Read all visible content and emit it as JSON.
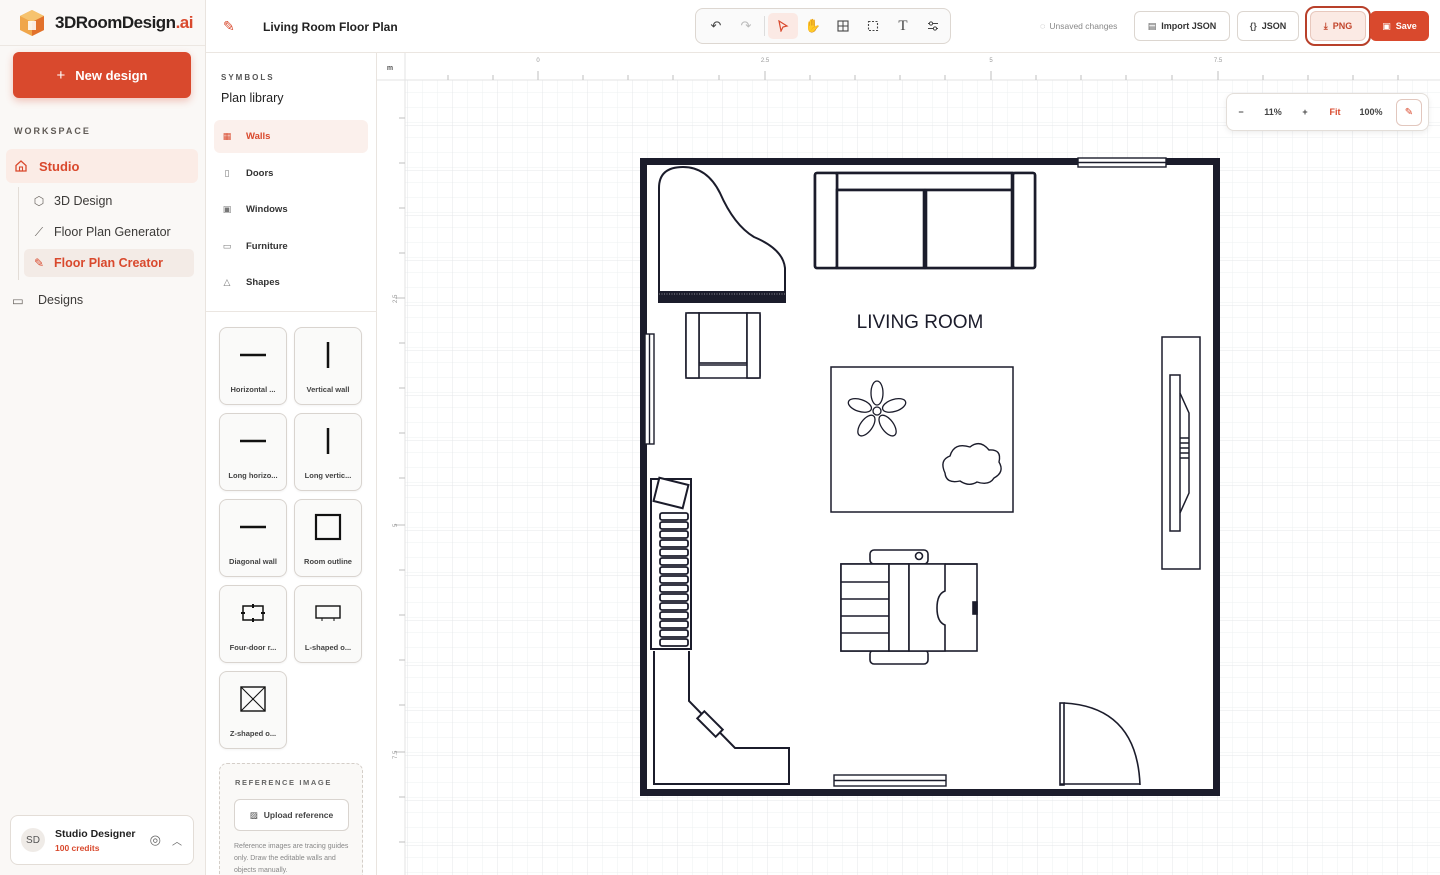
{
  "brand": {
    "name_main": "3DRoomDesign",
    "name_suffix": ".ai"
  },
  "sidebar": {
    "new_design": "New design",
    "workspace_label": "WORKSPACE",
    "studio": "Studio",
    "items": [
      {
        "label": "3D Design",
        "icon": "cube-icon"
      },
      {
        "label": "Floor Plan Generator",
        "icon": "magic-wand-icon"
      },
      {
        "label": "Floor Plan Creator",
        "icon": "ruler-icon",
        "active": true
      }
    ],
    "designs": "Designs",
    "user": {
      "initials": "SD",
      "name": "Studio Designer",
      "credits": "100 credits"
    }
  },
  "header": {
    "title": "Living Room Floor Plan",
    "unsaved": "Unsaved changes",
    "import_json": "Import JSON",
    "json": "JSON",
    "png": "PNG",
    "save": "Save",
    "tools": [
      "undo-icon",
      "redo-icon",
      "select-icon",
      "hand-icon",
      "grid-icon",
      "marquee-icon",
      "text-icon",
      "settings-icon"
    ]
  },
  "symbols": {
    "section_label": "SYMBOLS",
    "title": "Plan library",
    "categories": [
      "Walls",
      "Doors",
      "Windows",
      "Furniture",
      "Shapes"
    ],
    "tiles": [
      "Horizontal ...",
      "Vertical wall",
      "Long horizo...",
      "Long vertic...",
      "Diagonal wall",
      "Room outline",
      "Four-door r...",
      "L-shaped o...",
      "Z-shaped o..."
    ],
    "reference": {
      "label": "REFERENCE IMAGE",
      "upload": "Upload reference",
      "note": "Reference images are tracing guides only. Draw the editable walls and objects manually."
    }
  },
  "canvas": {
    "unit": "m",
    "ruler_x": [
      "0",
      "2.5",
      "5",
      "7.5"
    ],
    "ruler_y": [
      "2.5",
      "5",
      "7.5"
    ],
    "room_label": "LIVING ROOM",
    "zoom": {
      "minus": "−",
      "value": "11%",
      "plus": "+",
      "fit": "Fit",
      "full": "100%"
    }
  },
  "colors": {
    "accent": "#d9492d",
    "grid": "#eef0f2",
    "wall": "#1b1c2b"
  }
}
